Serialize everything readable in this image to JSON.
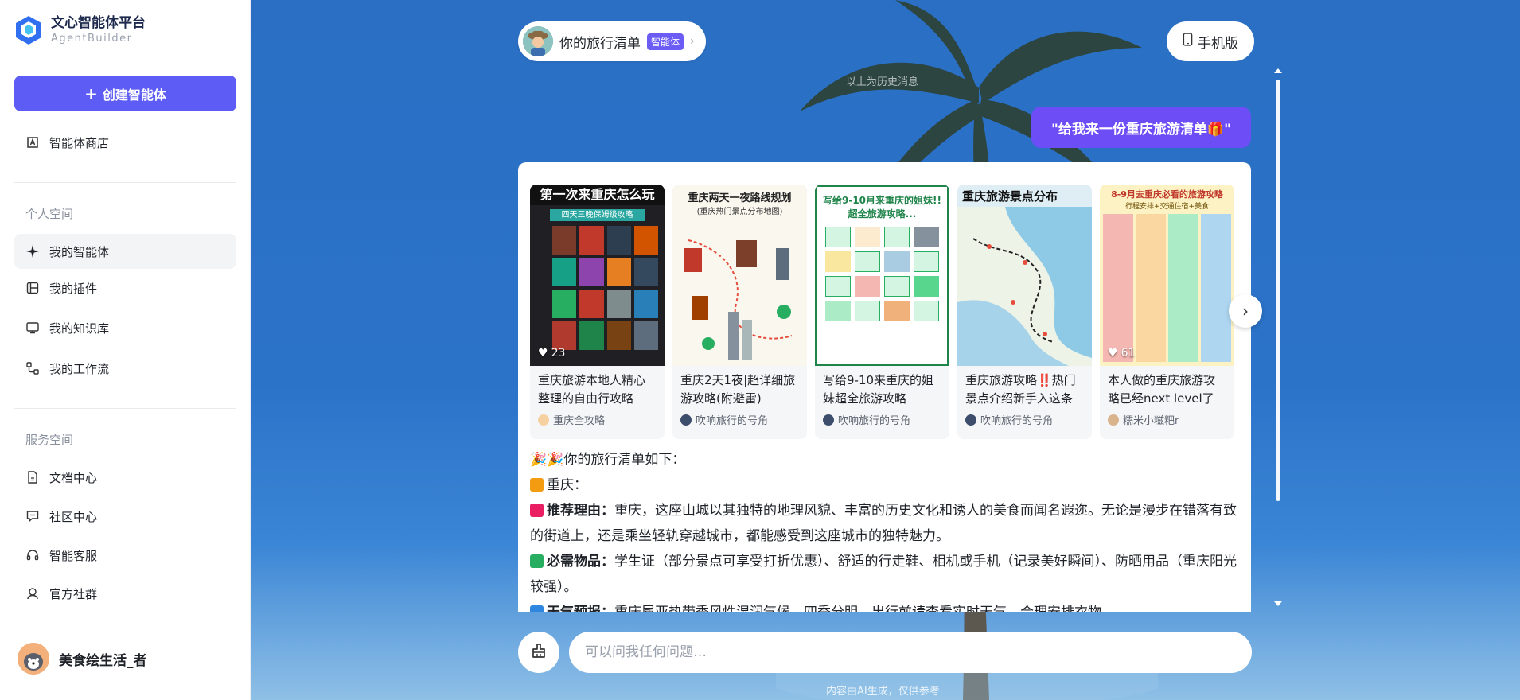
{
  "brand": {
    "name": "文心智能体平台",
    "sub": "AgentBuilder"
  },
  "sidebar": {
    "create_label": "创建智能体",
    "store_label": "智能体商店",
    "personal_section": "个人空间",
    "personal_items": [
      {
        "label": "我的智能体",
        "icon": "sparkle-icon",
        "active": true
      },
      {
        "label": "我的插件",
        "icon": "plugin-icon",
        "active": false
      },
      {
        "label": "我的知识库",
        "icon": "knowledge-icon",
        "active": false
      },
      {
        "label": "我的工作流",
        "icon": "workflow-icon",
        "active": false
      }
    ],
    "service_section": "服务空间",
    "service_items": [
      {
        "label": "文档中心",
        "icon": "document-icon"
      },
      {
        "label": "社区中心",
        "icon": "community-icon"
      },
      {
        "label": "智能客服",
        "icon": "headset-icon"
      },
      {
        "label": "官方社群",
        "icon": "group-icon"
      }
    ],
    "user_name": "美食绘生活_者"
  },
  "header": {
    "agent_name": "你的旅行清单",
    "agent_badge": "智能体",
    "mobile_label": "手机版"
  },
  "chat": {
    "history_note": "以上为历史消息",
    "user_message": "\"给我来一份重庆旅游清单🎁\"",
    "notes": [
      {
        "title": "重庆旅游本地人精心整理的自由行攻略",
        "author": "重庆全攻略",
        "likes": "23",
        "img_title": "第一次来重庆怎么玩",
        "img_sub": "四天三晚保姆级攻略"
      },
      {
        "title": "重庆2天1夜|超详细旅游攻略(附避雷)",
        "author": "吹响旅行的号角",
        "likes": "",
        "img_title": "重庆两天一夜路线规划",
        "img_sub": "(重庆热门景点分布地图)"
      },
      {
        "title": "写给9-10来重庆的姐妹超全旅游攻略",
        "author": "吹响旅行的号角",
        "likes": "",
        "img_title": "写给9-10月来重庆的姐妹!!",
        "img_sub": "超全旅游攻略..."
      },
      {
        "title": "重庆旅游攻略‼️热门景点介绍新手入这条",
        "author": "吹响旅行的号角",
        "likes": "",
        "img_title": "重庆旅游景点分布",
        "img_sub": ""
      },
      {
        "title": "本人做的重庆旅游攻略已经next level了",
        "author": "糯米小糍粑r",
        "likes": "61",
        "img_title": "8-9月去重庆必看的旅游攻略",
        "img_sub": "行程安排+交通住宿+美食"
      }
    ],
    "answer": {
      "intro": "🎉🎉你的旅行清单如下：",
      "city": "重庆：",
      "reason_label": "推荐理由：",
      "reason": "重庆，这座山城以其独特的地理风貌、丰富的历史文化和诱人的美食而闻名遐迩。无论是漫步在错落有致的街道上，还是乘坐轻轨穿越城市，都能感受到这座城市的独特魅力。",
      "items_label": "必需物品：",
      "items": "学生证（部分景点可享受打折优惠）、舒适的行走鞋、相机或手机（记录美好瞬间）、防晒用品（重庆阳光较强）。",
      "weather_label": "天气预报：",
      "weather": "重庆属亚热带季风性湿润气候，四季分明，出行前请查看实时天气，合理安排衣物。"
    }
  },
  "input": {
    "placeholder": "可以问我任何问题…"
  },
  "footer": {
    "disclaimer": "内容由AI生成，仅供参考"
  },
  "colors": {
    "accent": "#5d5cf4",
    "user_bubble": "#6c4df6",
    "badge": "#6b5cf5"
  }
}
